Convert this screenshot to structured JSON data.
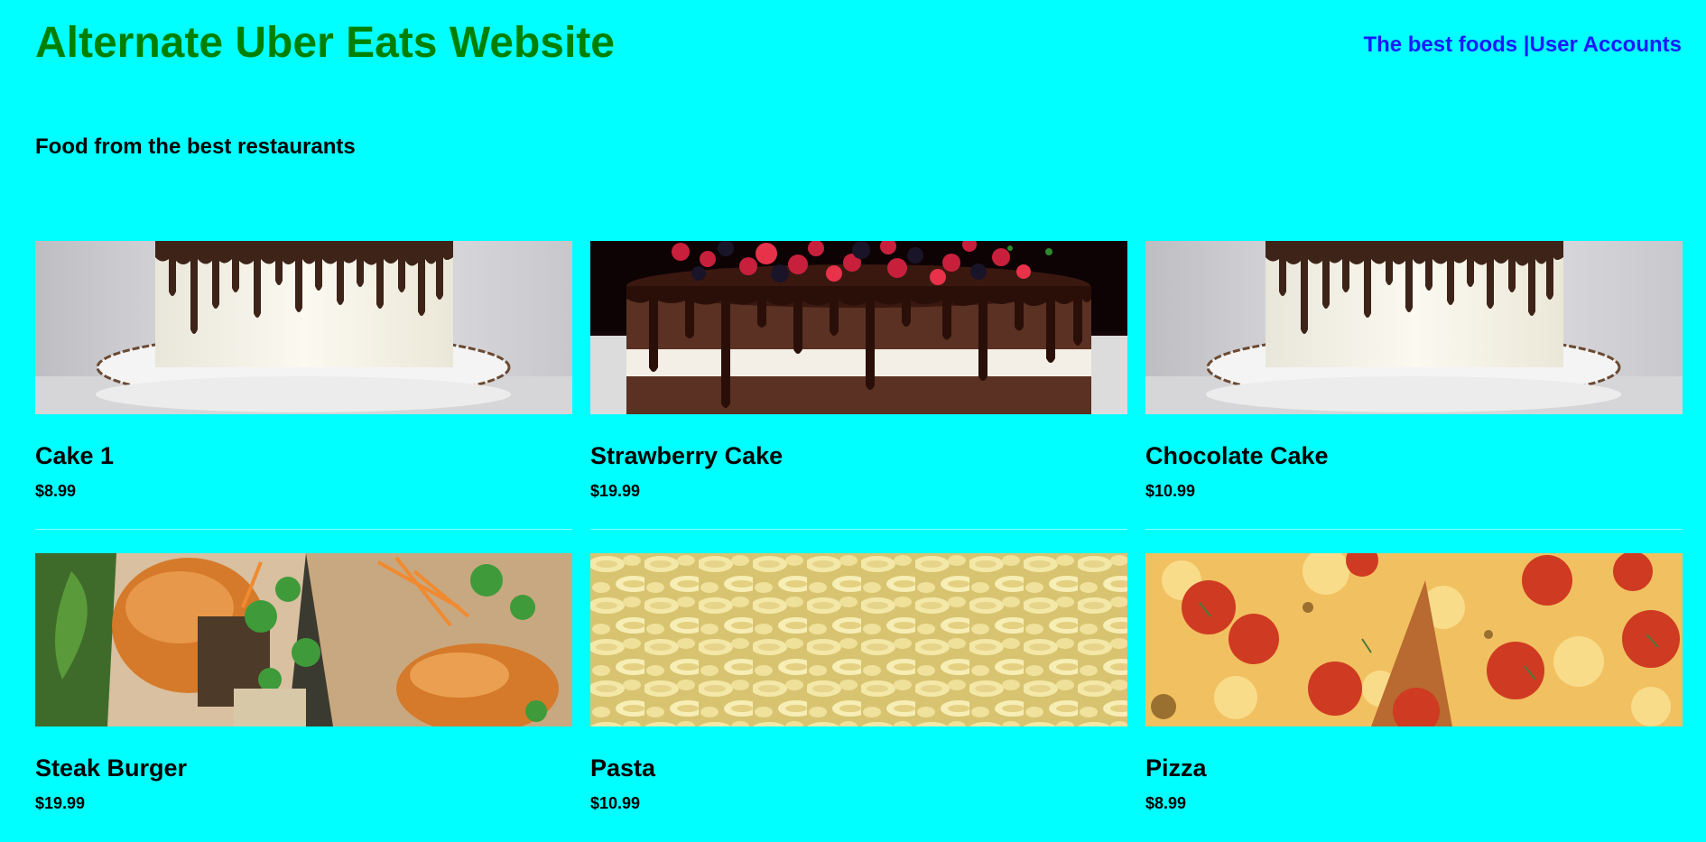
{
  "header": {
    "title": "Alternate Uber Eats Website",
    "nav_best_foods": "The best foods |",
    "nav_user_accounts": "User Accounts"
  },
  "tagline": "Food from the best restaurants",
  "colors": {
    "background": "#00ffff",
    "title": "#008000",
    "nav_link": "#1a1aff"
  },
  "items": [
    {
      "name": "Cake 1",
      "price": "$8.99",
      "image": "drip-cake-photo"
    },
    {
      "name": "Strawberry Cake",
      "price": "$19.99",
      "image": "berry-cake-photo"
    },
    {
      "name": "Chocolate Cake",
      "price": "$10.99",
      "image": "drip-cake-photo"
    },
    {
      "name": "Steak Burger",
      "price": "$19.99",
      "image": "burger-photo"
    },
    {
      "name": "Pasta",
      "price": "$10.99",
      "image": "pasta-photo"
    },
    {
      "name": "Pizza",
      "price": "$8.99",
      "image": "pizza-photo"
    }
  ]
}
